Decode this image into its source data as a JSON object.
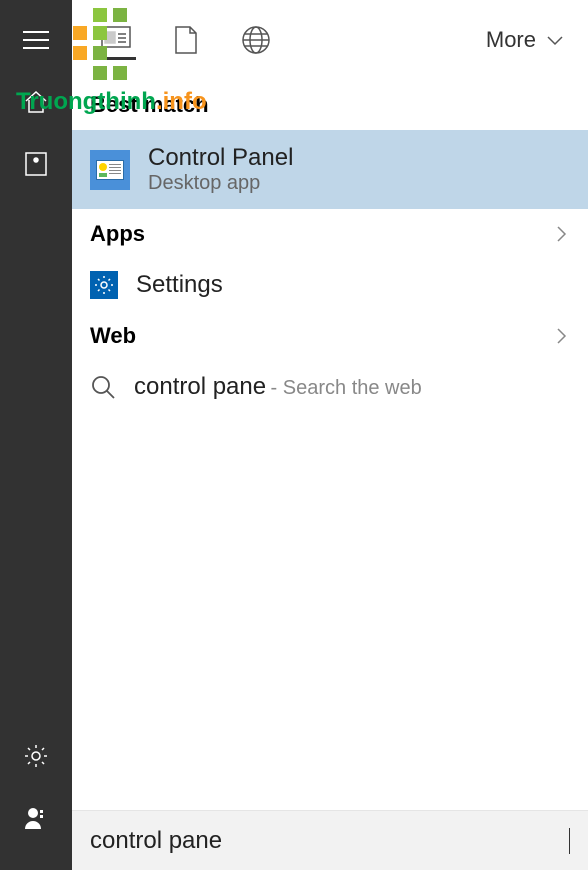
{
  "watermark": {
    "name": "Truongthinh",
    "suffix": ".info"
  },
  "filters": {
    "more_label": "More"
  },
  "sections": {
    "best_match": {
      "header": "Best match"
    },
    "apps": {
      "header": "Apps"
    },
    "web": {
      "header": "Web"
    }
  },
  "best_match_result": {
    "title": "Control Panel",
    "subtitle": "Desktop app"
  },
  "apps_result": {
    "label": "Settings"
  },
  "web_result": {
    "query": "control pane",
    "suffix": "- Search the web"
  },
  "search": {
    "value": "control pane"
  }
}
